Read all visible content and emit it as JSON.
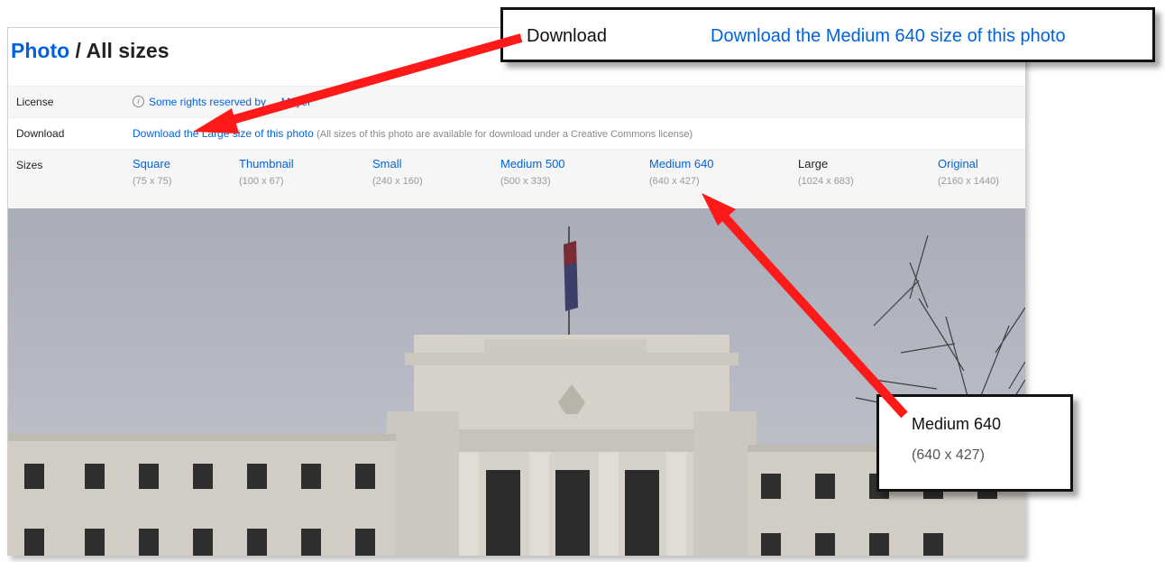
{
  "page": {
    "title_link": "Photo",
    "title_rest": " / All sizes"
  },
  "license": {
    "label": "License",
    "icon": "info-icon",
    "text": "Some rights reserved by ... Mayer"
  },
  "download": {
    "label": "Download",
    "link": "Download the Large size of this photo",
    "note": "(All sizes of this photo are available for download under a Creative Commons license)"
  },
  "sizes": {
    "label": "Sizes",
    "items": [
      {
        "name": "Square",
        "dims": "(75 x 75)"
      },
      {
        "name": "Thumbnail",
        "dims": "(100 x 67)"
      },
      {
        "name": "Small",
        "dims": "(240 x 160)"
      },
      {
        "name": "Medium 500",
        "dims": "(500 x 333)"
      },
      {
        "name": "Medium 640",
        "dims": "(640 x 427)"
      },
      {
        "name": "Large",
        "dims": "(1024 x 683)"
      },
      {
        "name": "Original",
        "dims": "(2160 x 1440)"
      }
    ],
    "current": "Large"
  },
  "callouts": {
    "download_label": "Download",
    "download_link": "Download the Medium 640 size of this photo",
    "medium_name": "Medium 640",
    "medium_dims": "(640 x 427)"
  },
  "colors": {
    "link": "#0063dc",
    "arrow": "#ff1a1a",
    "sky": "#b9bcc6",
    "building": "#d8d4cc"
  }
}
